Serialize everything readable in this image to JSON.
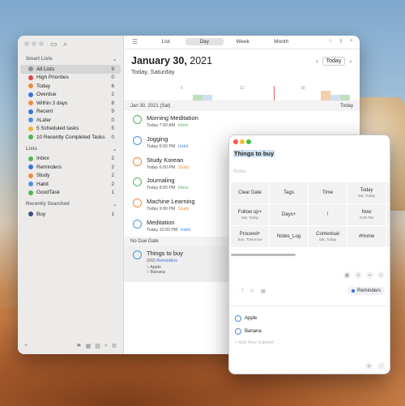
{
  "sidebar": {
    "smart_lists_header": "Smart Lists",
    "smart_lists": [
      {
        "label": "All Lists",
        "count": "9",
        "color": "#8e8e93"
      },
      {
        "label": "High Priorities",
        "count": "0",
        "color": "#e0414e"
      },
      {
        "label": "Today",
        "count": "6",
        "color": "#f08a3c"
      },
      {
        "label": "Overdue",
        "count": "2",
        "color": "#3b73d6"
      },
      {
        "label": "Within 3 days",
        "count": "8",
        "color": "#f08a3c"
      },
      {
        "label": "Recent",
        "count": "9",
        "color": "#3b73d6"
      },
      {
        "label": "#Later",
        "count": "0",
        "color": "#4c8fe0"
      },
      {
        "label": "5 Scheduled tasks",
        "count": "5",
        "color": "#f0b33c"
      },
      {
        "label": "10 Recently Completed Tasks",
        "count": "0",
        "color": "#52b45a"
      }
    ],
    "lists_header": "Lists",
    "lists": [
      {
        "label": "Inbox",
        "count": "2",
        "color": "#52b45a"
      },
      {
        "label": "Reminders",
        "count": "2",
        "color": "#3b73d6"
      },
      {
        "label": "Study",
        "count": "2",
        "color": "#f08a3c"
      },
      {
        "label": "Habit",
        "count": "2",
        "color": "#4c8fe0"
      },
      {
        "label": "GoodTask",
        "count": "1",
        "color": "#52b45a"
      }
    ],
    "recent_header": "Recently Searched",
    "recent": [
      {
        "label": "Buy",
        "count": "1",
        "color": "#3d4f7a"
      }
    ]
  },
  "toolbar": {
    "tabs": [
      "List",
      "Day",
      "Week",
      "Month"
    ],
    "active_tab": "Day"
  },
  "date_header": {
    "date_bold": "January 30,",
    "year": " 2021",
    "subtitle": "Today, Saturday",
    "today_button": "Today"
  },
  "timeline": {
    "ticks": [
      "6",
      "12",
      "18"
    ]
  },
  "day_band": {
    "label": "Jan 30, 2021 (Sat)",
    "right": "Today"
  },
  "tasks": [
    {
      "title": "Morning Meditation",
      "time": "Today 7:00 AM",
      "list": "Inbox",
      "color": "#52b45a"
    },
    {
      "title": "Jogging",
      "time": "Today 6:00 PM",
      "list": "Habit",
      "color": "#4c8fe0"
    },
    {
      "title": "Study Korean",
      "time": "Today 6:00 PM",
      "list": "Study",
      "color": "#f08a3c"
    },
    {
      "title": "Journaling",
      "time": "Today 8:00 PM",
      "list": "Inbox",
      "color": "#52b45a"
    },
    {
      "title": "Machine Learning",
      "time": "Today 9:00 PM",
      "list": "Study",
      "color": "#f08a3c"
    },
    {
      "title": "Meditation",
      "time": "Today 10:00 PM",
      "list": "Habit",
      "color": "#4c8fe0"
    }
  ],
  "no_due": {
    "header": "No Due Date",
    "title": "Things to buy",
    "meta": "(0/2)",
    "list": "Reminders",
    "sub1": "Apple",
    "sub2": "Banana"
  },
  "detail": {
    "title": "Things to buy",
    "notes_placeholder": "Notes",
    "grid": [
      {
        "label": "Clear Date",
        "sub": ""
      },
      {
        "label": "Tags",
        "sub": ""
      },
      {
        "label": "Time",
        "sub": ""
      },
      {
        "label": "Today",
        "sub": "Sat, Today"
      },
      {
        "label": "Follow up+",
        "sub": "Sat, Today"
      },
      {
        "label": "Days+",
        "sub": ""
      },
      {
        "label": "!",
        "sub": ""
      },
      {
        "label": "Now",
        "sub": "5:26 PM"
      },
      {
        "label": "Proceed+",
        "sub": "Sun, Tomorrow"
      },
      {
        "label": "Notes_Log",
        "sub": ""
      },
      {
        "label": "Contextual",
        "sub": "Sat, Today"
      },
      {
        "label": "#Home",
        "sub": ""
      }
    ],
    "list_pill": "Reminders",
    "subtasks": [
      "Apple",
      "Banana"
    ],
    "add_subtask_placeholder": "Add New Subtask"
  }
}
